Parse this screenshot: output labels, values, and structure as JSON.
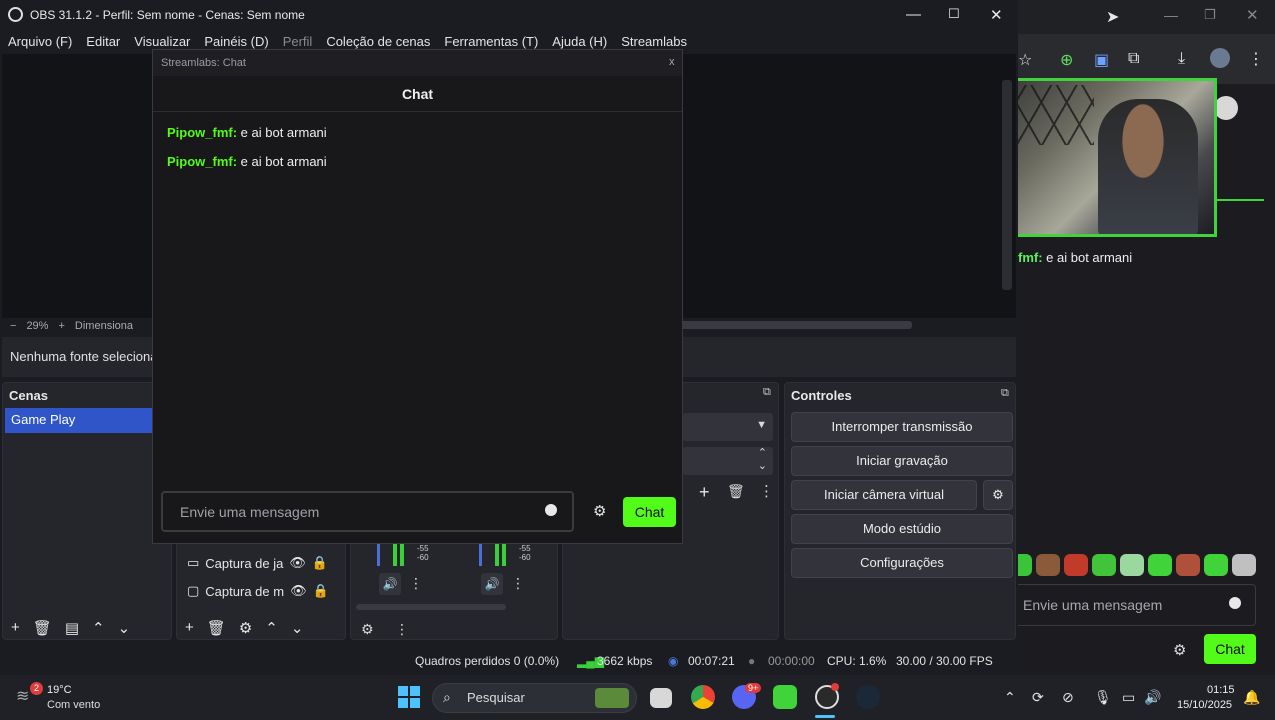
{
  "obs": {
    "title": "OBS 31.1.2 - Perfil: Sem nome - Cenas: Sem nome",
    "menu": [
      "Arquivo (F)",
      "Editar",
      "Visualizar",
      "Painéis (D)",
      "Perfil",
      "Coleção de cenas",
      "Ferramentas (T)",
      "Ajuda (H)",
      "Streamlabs"
    ],
    "zoom": {
      "minus": "−",
      "value": "29%",
      "plus": "+",
      "label": "Dimensionar"
    },
    "no_source": "Nenhuma fonte selecionada",
    "scenes": {
      "title": "Cenas",
      "items": [
        "Game Play"
      ]
    },
    "sources": {
      "items": [
        {
          "label": "Captura de ja"
        },
        {
          "label": "Captura de m"
        }
      ]
    },
    "mixer": {
      "db_labels": [
        "-55",
        "-60"
      ]
    },
    "controls": {
      "title": "Controles",
      "buttons": [
        "Interromper transmissão",
        "Iniciar gravação",
        "Iniciar câmera virtual",
        "Modo estúdio",
        "Configurações"
      ]
    },
    "status": {
      "dropped": "Quadros perdidos 0 (0.0%)",
      "bitrate": "3662 kbps",
      "stream_time": "00:07:21",
      "rec_time": "00:00:00",
      "cpu": "CPU: 1.6%",
      "fps": "30.00 / 30.00 FPS"
    }
  },
  "chat_popup": {
    "window_title": "Streamlabs: Chat",
    "close": "x",
    "header": "Chat",
    "messages": [
      {
        "user": "Pipow_fmf:",
        "text": " e ai bot armani"
      },
      {
        "user": "Pipow_fmf:",
        "text": " e ai bot armani"
      }
    ],
    "input_placeholder": "Envie uma mensagem",
    "send_label": "Chat"
  },
  "browser": {
    "chat_line": {
      "user": "fmf:",
      "text": " e ai bot armani"
    },
    "input_placeholder": "Envie uma mensagem",
    "send_label": "Chat"
  },
  "taskbar": {
    "weather_badge": "2",
    "temp": "19°C",
    "weather": "Com vento",
    "search": "Pesquisar",
    "time": "01:15",
    "date": "15/10/2025"
  },
  "colors": {
    "accent_green": "#53fc18",
    "scene_selected": "#2f55c9",
    "panel": "#25262c"
  }
}
